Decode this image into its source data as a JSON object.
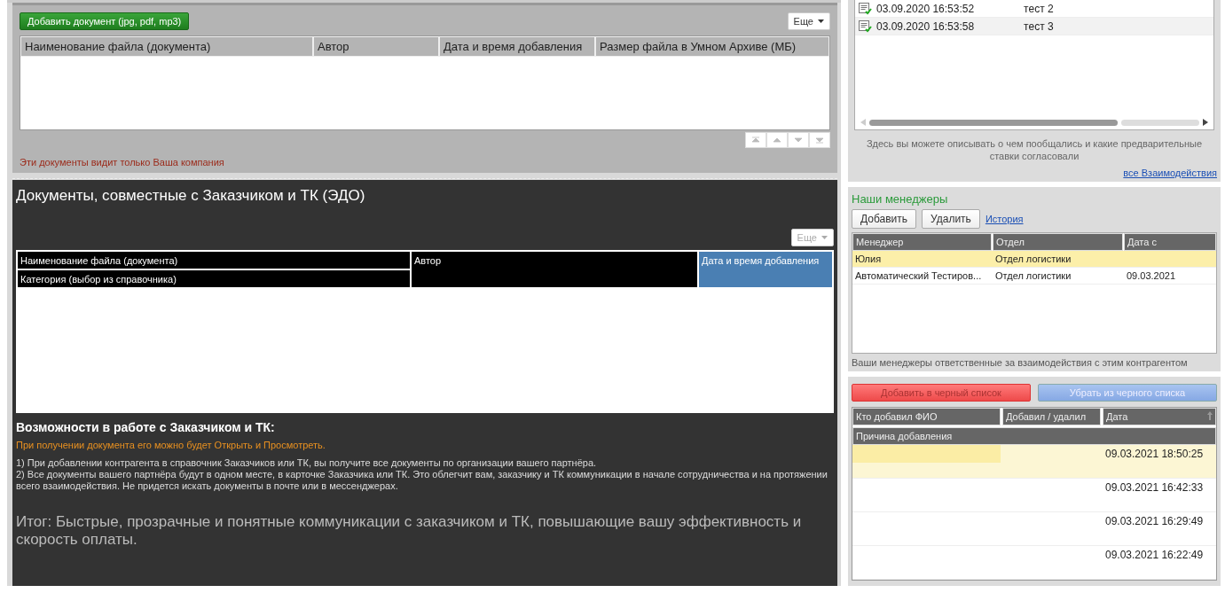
{
  "documents": {
    "add_button": "Добавить документ (jpg, pdf, mp3)",
    "more_button": "Еще",
    "columns": [
      "Наименование файла (документа)",
      "Автор",
      "Дата и время добавления",
      "Размер файла в Умном Архиве (МБ)"
    ],
    "note": "Эти документы видит только Ваша компания"
  },
  "edo": {
    "title": "Документы, совместные с Заказчиком и ТК (ЭДО)",
    "more_button": "Еще",
    "columns": [
      {
        "label": "Наименование файла (документа)",
        "selected": false
      },
      {
        "label": "Категория (выбор из справочника)",
        "selected": false
      },
      {
        "label": "Автор",
        "selected": false
      },
      {
        "label": "Дата и время добавления",
        "selected": true
      }
    ],
    "features_title": "Возможности в работе с Заказчиком и ТК:",
    "highlight": "При получении документа его можно будет Открыть и Просмотреть.",
    "points": [
      "1) При добавлении контрагента в справочник Заказчиков или ТК, вы получите все документы по организации вашего партнёра.",
      "2) Все документы вашего партнёра будут в одном месте, в карточке Заказчика или ТК. Это облегчит вам, заказчику и ТК коммуникации в начале сотрудничества и на протяжении всего взаимодействия. Не придется искать документы в почте или в мессенджерах."
    ],
    "summary": "Итог: Быстрые, прозрачные и понятные коммуникации с заказчиком и ТК, повышающие вашу эффективность и скорость оплаты."
  },
  "interactions": {
    "rows": [
      {
        "date": "03.09.2020 16:53:52",
        "text": "тест 2",
        "selected": false
      },
      {
        "date": "03.09.2020 16:53:58",
        "text": "тест 3",
        "selected": true
      }
    ],
    "hint": "Здесь вы можете описывать о чем пообщались и какие предварительные ставки согласовали",
    "link": "все Взаимодействия"
  },
  "managers": {
    "title": "Наши менеджеры",
    "add_button": "Добавить",
    "delete_button": "Удалить",
    "history_link": "История",
    "columns": [
      "Менеджер",
      "Отдел",
      "Дата с"
    ],
    "rows": [
      {
        "manager": "Юлия",
        "department": "Отдел логистики",
        "date": "",
        "selected": true
      },
      {
        "manager": "Автоматический Тестиров...",
        "department": "Отдел логистики",
        "date": "09.03.2021",
        "selected": false
      }
    ],
    "hint": "Ваши менеджеры ответственные за взаимодействия с этим контрагентом"
  },
  "blacklist": {
    "add_button": "Добавить в черный список",
    "remove_button": "Убрать из черного списка",
    "columns": [
      "Кто добавил ФИО",
      "Добавил / удалил",
      "Дата"
    ],
    "reason_column": "Причина добавления",
    "rows": [
      {
        "date": "09.03.2021 18:50:25",
        "selected": true
      },
      {
        "date": "09.03.2021 16:42:33",
        "selected": false
      },
      {
        "date": "09.03.2021 16:29:49",
        "selected": false
      },
      {
        "date": "09.03.2021 16:22:49",
        "selected": false
      }
    ]
  }
}
